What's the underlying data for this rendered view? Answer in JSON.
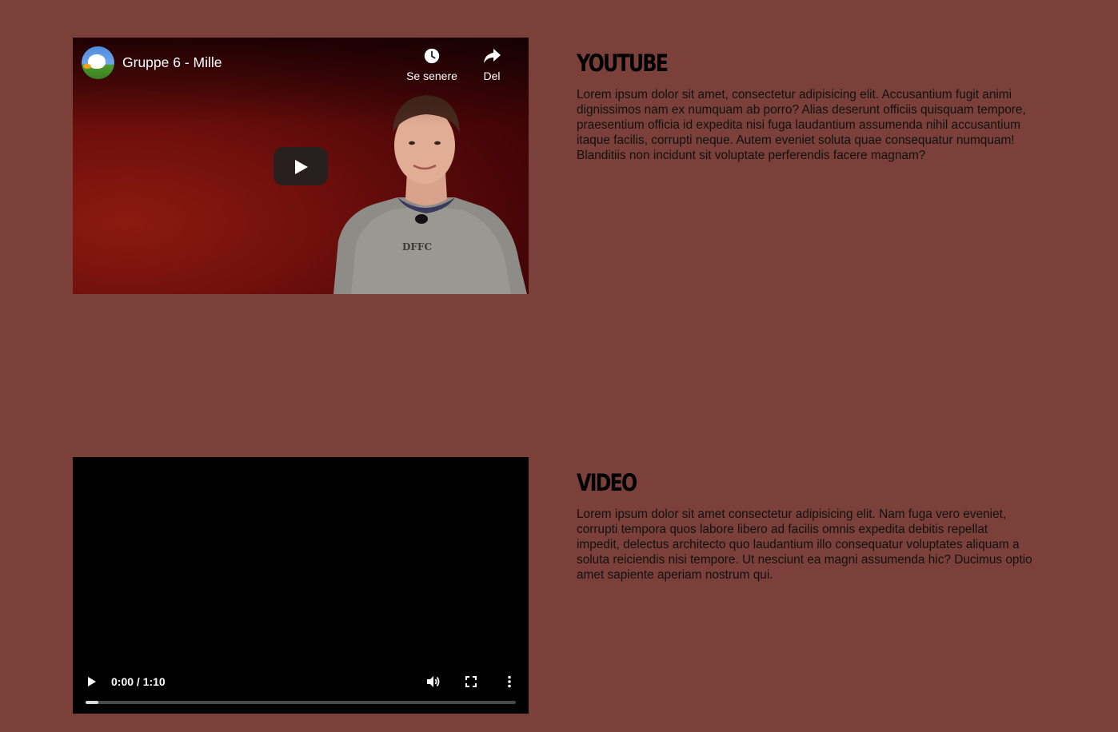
{
  "youtube_section": {
    "heading": "YOUTUBE",
    "text": "Lorem ipsum dolor sit amet, consectetur adipisicing elit. Accusantium fugit animi dignissimos nam ex numquam ab porro? Alias deserunt officiis quisquam tempore, praesentium officia id expedita nisi fuga laudantium assumenda nihil accusantium itaque facilis, corrupti neque. Autem eveniet soluta quae consequatur numquam! Blanditiis non incidunt sit voluptate perferendis facere magnam?",
    "player": {
      "video_title": "Gruppe 6 - Mille",
      "watch_later_label": "Se senere",
      "share_label": "Del",
      "shirt_text": "DFFC",
      "icons": {
        "watch_later": "clock-icon",
        "share": "share-arrow-icon",
        "play": "play-icon",
        "channel": "channel-avatar"
      }
    }
  },
  "video_section": {
    "heading": "VIDEO",
    "text": "Lorem ipsum dolor sit amet consectetur adipisicing elit. Nam fuga vero eveniet, corrupti tempora quos labore libero ad facilis omnis expedita debitis repellat impedit, delectus architecto quo laudantium illo consequatur voluptates aliquam a soluta reiciendis nisi tempore. Ut nesciunt ea magni assumenda hic? Ducimus optio amet sapiente aperiam nostrum qui.",
    "player": {
      "time_display": "0:00 / 1:10",
      "progress_fraction": 0.03,
      "icons": {
        "play": "play-icon",
        "volume": "volume-icon",
        "fullscreen": "fullscreen-icon",
        "more": "more-vertical-icon"
      }
    }
  },
  "colors": {
    "page_background": "#7a4039",
    "heading_text": "#000000",
    "body_text": "#111111"
  }
}
